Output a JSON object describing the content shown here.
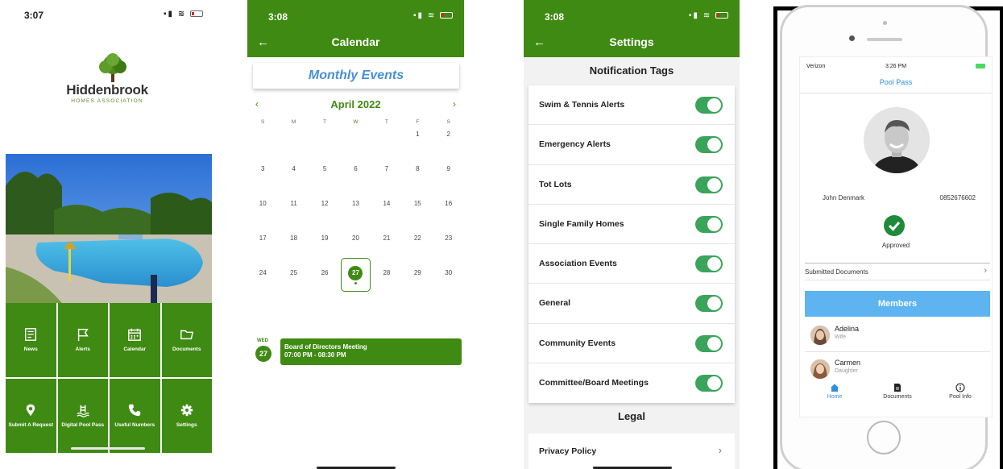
{
  "colors": {
    "primary_green": "#3f8a13",
    "accent_blue": "#4a8fd8",
    "toggle_green": "#3aa45a",
    "members_blue": "#5db4f0",
    "approved_green": "#1e8a3a"
  },
  "home": {
    "time": "3:07",
    "logo": {
      "name": "Hiddenbrook",
      "subtitle": "HOMES ASSOCIATION"
    },
    "tiles": [
      {
        "label": "News",
        "icon": "news-icon"
      },
      {
        "label": "Alerts",
        "icon": "flag-icon"
      },
      {
        "label": "Calendar",
        "icon": "calendar-icon"
      },
      {
        "label": "Documents",
        "icon": "folder-icon"
      },
      {
        "label": "Submit A Request",
        "icon": "location-pin-icon"
      },
      {
        "label": "Digital Pool Pass",
        "icon": "pool-ladder-icon"
      },
      {
        "label": "Useful Numbers",
        "icon": "phone-icon"
      },
      {
        "label": "Settings",
        "icon": "gear-icon"
      }
    ]
  },
  "calendar": {
    "time": "3:08",
    "title": "Calendar",
    "banner": "Monthly Events",
    "month": "April 2022",
    "weekdays": [
      "S",
      "M",
      "T",
      "W",
      "T",
      "F",
      "S"
    ],
    "weeks": [
      [
        "",
        "",
        "",
        "",
        "",
        "1",
        "2"
      ],
      [
        "3",
        "4",
        "5",
        "6",
        "7",
        "8",
        "9"
      ],
      [
        "10",
        "11",
        "12",
        "13",
        "14",
        "15",
        "16"
      ],
      [
        "17",
        "18",
        "19",
        "20",
        "21",
        "22",
        "23"
      ],
      [
        "24",
        "25",
        "26",
        "27",
        "28",
        "29",
        "30"
      ]
    ],
    "selected_day": "27",
    "event": {
      "dow": "WED",
      "date": "27",
      "title": "Board of Directors Meeting",
      "time": "07:00 PM - 08:30 PM"
    }
  },
  "settings": {
    "time": "3:08",
    "title": "Settings",
    "tags_header": "Notification Tags",
    "tags": [
      {
        "label": "Swim & Tennis Alerts",
        "on": true
      },
      {
        "label": "Emergency Alerts",
        "on": true
      },
      {
        "label": "Tot Lots",
        "on": true
      },
      {
        "label": "Single Family Homes",
        "on": true
      },
      {
        "label": "Association Events",
        "on": true
      },
      {
        "label": "General",
        "on": true
      },
      {
        "label": "Community Events",
        "on": true
      },
      {
        "label": "Committee/Board Meetings",
        "on": true
      }
    ],
    "legal_header": "Legal",
    "privacy": "Privacy Policy"
  },
  "poolpass": {
    "carrier": "Verizon",
    "time": "3:26 PM",
    "title": "Pool Pass",
    "name": "John Denmark",
    "phone": "0852676602",
    "status": "Approved",
    "submitted_documents": "Submitted Documents",
    "members_header": "Members",
    "members": [
      {
        "name": "Adelina",
        "relation": "Wife"
      },
      {
        "name": "Carmen",
        "relation": "Daughter"
      }
    ],
    "tabs": [
      "Home",
      "Documents",
      "Pool Info"
    ]
  }
}
